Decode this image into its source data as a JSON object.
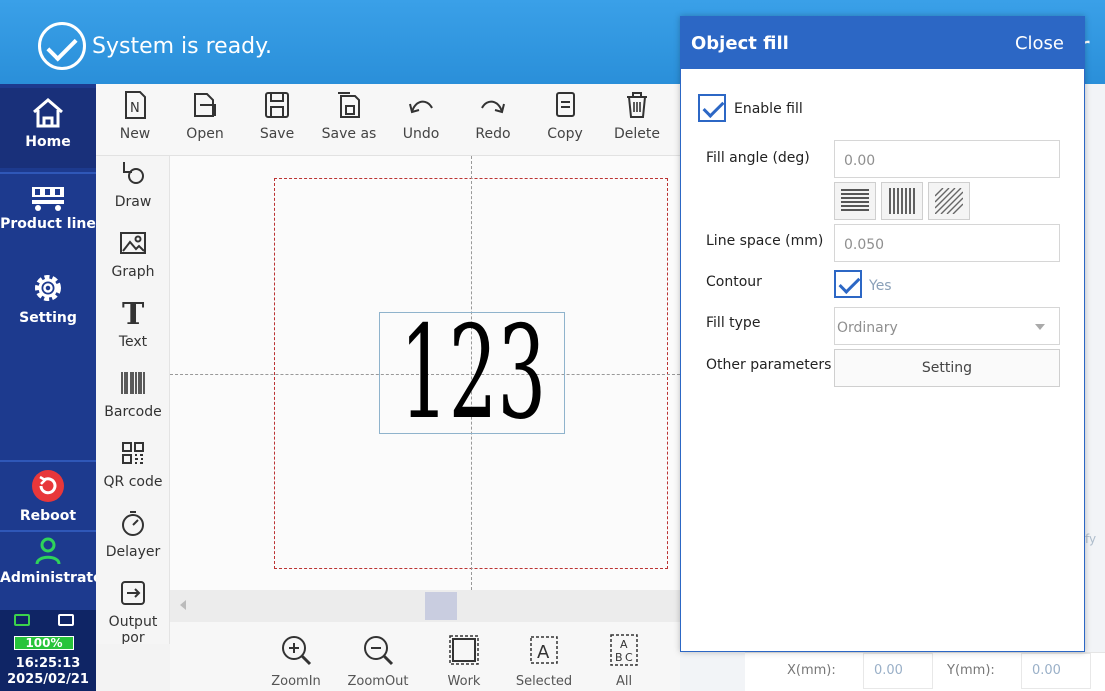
{
  "status": {
    "text": "System is ready.",
    "trailing_char": "r"
  },
  "nav": {
    "items": [
      {
        "label": "Home",
        "icon": "home-icon"
      },
      {
        "label": "Product line",
        "icon": "product-line-icon"
      },
      {
        "label": "Setting",
        "icon": "gear-icon"
      },
      {
        "label": "Reboot",
        "icon": "reboot-icon"
      },
      {
        "label": "Administrator",
        "icon": "user-icon"
      }
    ],
    "battery": "100%",
    "time": "16:25:13",
    "date": "2025/02/21"
  },
  "toolbar": {
    "items": [
      {
        "label": "New",
        "icon": "new-file-icon"
      },
      {
        "label": "Open",
        "icon": "open-folder-icon"
      },
      {
        "label": "Save",
        "icon": "save-icon"
      },
      {
        "label": "Save as",
        "icon": "save-as-icon"
      },
      {
        "label": "Undo",
        "icon": "undo-icon"
      },
      {
        "label": "Redo",
        "icon": "redo-icon"
      },
      {
        "label": "Copy",
        "icon": "copy-icon"
      },
      {
        "label": "Delete",
        "icon": "trash-icon"
      }
    ]
  },
  "palette": {
    "items": [
      {
        "label": "Draw",
        "icon": "draw-icon"
      },
      {
        "label": "Graph",
        "icon": "image-icon"
      },
      {
        "label": "Text",
        "icon": "text-icon"
      },
      {
        "label": "Barcode",
        "icon": "barcode-icon"
      },
      {
        "label": "QR code",
        "icon": "qr-code-icon"
      },
      {
        "label": "Delayer",
        "icon": "timer-icon"
      },
      {
        "label": "Output por",
        "icon": "output-port-icon"
      }
    ]
  },
  "canvas": {
    "object_text": "123"
  },
  "zoombar": {
    "items": [
      {
        "label": "ZoomIn",
        "icon": "zoom-in-icon"
      },
      {
        "label": "ZoomOut",
        "icon": "zoom-out-icon"
      },
      {
        "label": "Work",
        "icon": "work-area-icon"
      },
      {
        "label": "Selected",
        "icon": "selected-icon"
      },
      {
        "label": "All",
        "icon": "all-icon"
      }
    ]
  },
  "dialog": {
    "title": "Object fill",
    "close_label": "Close",
    "enable_fill_label": "Enable fill",
    "enable_fill_checked": true,
    "fill_angle_label": "Fill angle (deg)",
    "fill_angle_value": "0.00",
    "line_space_label": "Line space (mm)",
    "line_space_value": "0.050",
    "contour_label": "Contour",
    "contour_checked": true,
    "contour_value_label": "Yes",
    "fill_type_label": "Fill type",
    "fill_type_value": "Ordinary",
    "other_params_label": "Other parameters",
    "other_params_button": "Setting",
    "hatch_patterns": [
      "horizontal-lines-icon",
      "vertical-lines-icon",
      "diagonal-lines-icon"
    ]
  },
  "coords": {
    "x_label": "X(mm):",
    "x_value": "0.00",
    "y_label": "Y(mm):",
    "y_value": "0.00"
  },
  "background_fragments": {
    "fy": "fy"
  },
  "colors": {
    "accent": "#2c67c5",
    "nav_bg": "#1d3a8e",
    "status_bar": "#2a8fd9",
    "work_area_border": "#bb3333"
  }
}
